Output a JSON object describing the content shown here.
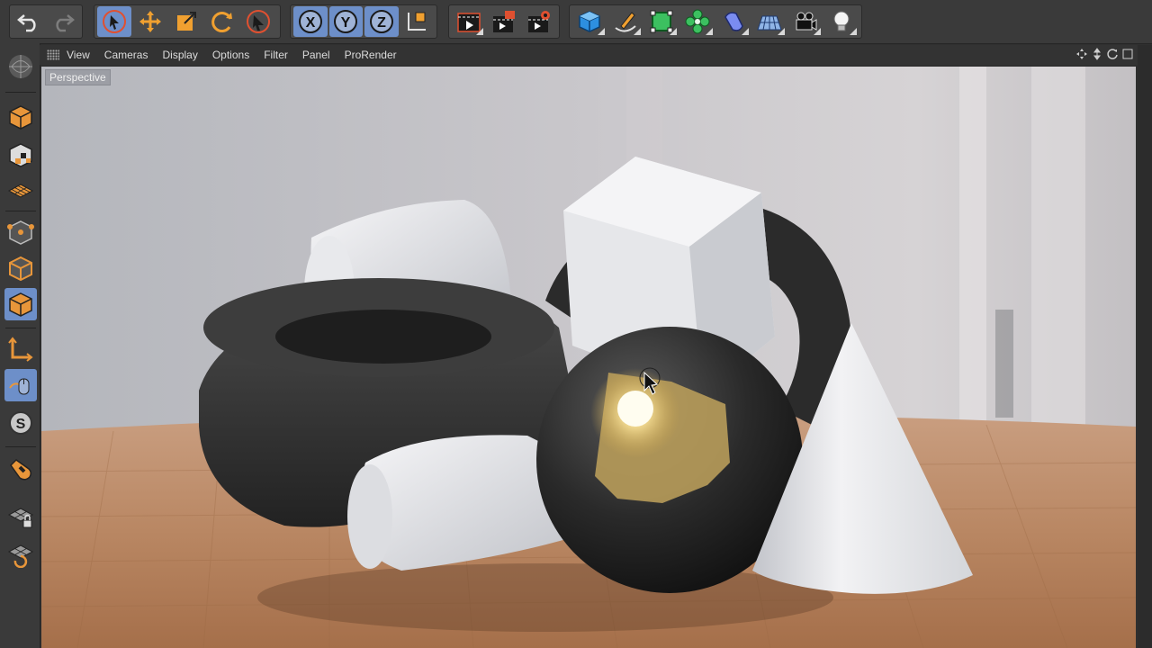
{
  "viewport": {
    "label": "Perspective"
  },
  "view_menu": {
    "items": [
      "View",
      "Cameras",
      "Display",
      "Options",
      "Filter",
      "Panel",
      "ProRender"
    ]
  },
  "toolbar": {
    "groups": [
      [
        "undo-icon",
        "redo-icon"
      ],
      [
        "live-selection-icon",
        "move-icon",
        "scale-icon",
        "rotate-icon",
        "selection-tool-icon"
      ],
      [
        "x-axis-lock-icon",
        "y-axis-lock-icon",
        "z-axis-lock-icon",
        "coordinate-system-icon"
      ],
      [
        "render-view-icon",
        "render-to-picture-viewer-icon",
        "render-settings-icon"
      ],
      [
        "cube-primitive-icon",
        "pen-spline-icon",
        "subdivision-surface-icon",
        "cloner-icon",
        "deformer-icon",
        "floor-icon",
        "camera-icon",
        "light-icon"
      ]
    ]
  },
  "left_toolbar": {
    "items": [
      "make-editable-icon",
      "texture-mode-icon",
      "workplane-icon",
      "points-mode-icon",
      "edges-mode-icon",
      "polygons-mode-icon",
      "axis-mode-icon",
      "tweak-mode-icon",
      "solo-icon",
      "snap-icon",
      "workplane-lock-icon",
      "workplane-rotate-icon"
    ]
  },
  "colors": {
    "accent": "#6d8fc9",
    "icon_orange": "#f0a030",
    "panel_bg": "#3a3a3a"
  }
}
